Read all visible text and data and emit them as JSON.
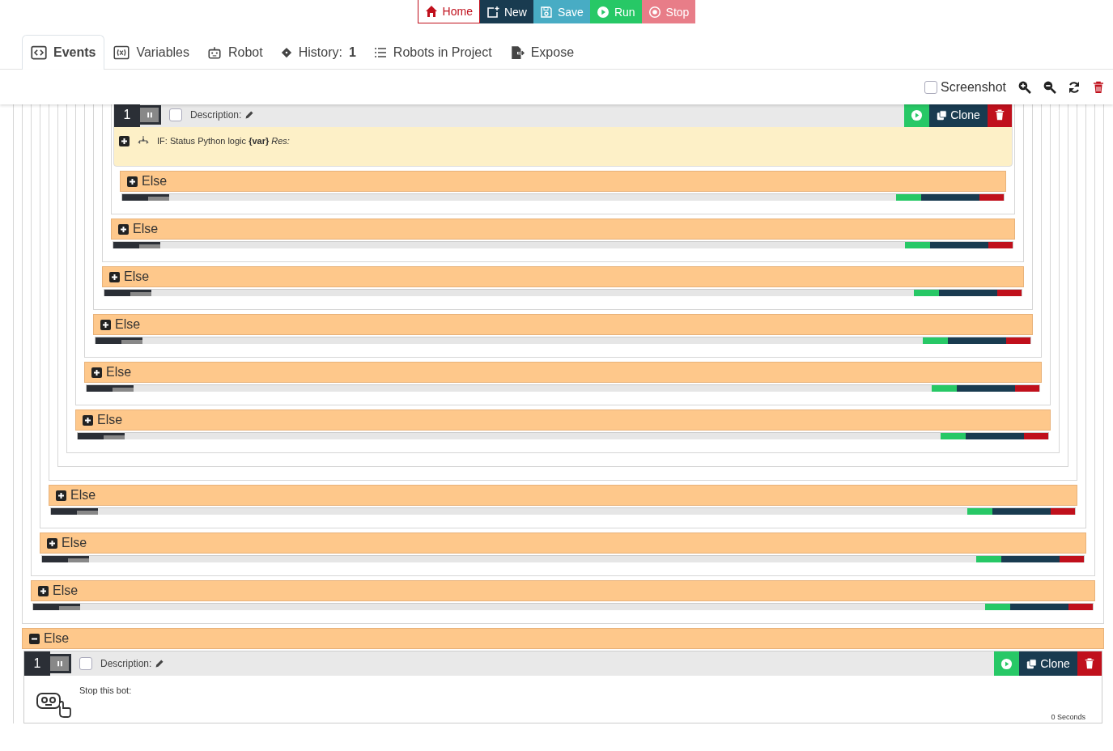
{
  "toolbar": [
    {
      "label": "Home",
      "kind": "home"
    },
    {
      "label": "New",
      "kind": "new"
    },
    {
      "label": "Save",
      "kind": "save"
    },
    {
      "label": "Run",
      "kind": "run"
    },
    {
      "label": "Stop",
      "kind": "stop"
    }
  ],
  "tabs": [
    {
      "label": "Events",
      "kind": "events",
      "selected": true
    },
    {
      "label": "Variables",
      "kind": "variables",
      "selected": false
    },
    {
      "label": "Robot",
      "kind": "robot",
      "selected": false
    },
    {
      "label": "History:",
      "count": "1",
      "kind": "history",
      "selected": false
    },
    {
      "label": "Robots in Project",
      "kind": "list",
      "selected": false
    },
    {
      "label": "Expose",
      "kind": "expose",
      "selected": false
    }
  ],
  "screenshot": {
    "label": "Screenshot",
    "checked": false
  },
  "top_event": {
    "number": "1",
    "checked": false,
    "description_label": "Description:",
    "clone_label": "Clone",
    "condition": "IF: Status Python logic **{var}** *Res:*"
  },
  "levels": [
    {
      "kind": "else",
      "label": "Else",
      "expanded": false
    },
    {
      "kind": "else",
      "label": "Else",
      "expanded": false
    },
    {
      "kind": "else",
      "label": "Else",
      "expanded": false
    },
    {
      "kind": "else",
      "label": "Else",
      "expanded": false
    },
    {
      "kind": "else",
      "label": "Else",
      "expanded": false
    },
    {
      "kind": "else",
      "label": "Else",
      "expanded": false
    },
    {
      "kind": "group"
    },
    {
      "kind": "group"
    },
    {
      "kind": "else",
      "label": "Else",
      "expanded": false
    },
    {
      "kind": "else",
      "label": "Else",
      "expanded": false
    },
    {
      "kind": "else",
      "label": "Else",
      "expanded": false
    },
    {
      "kind": "else",
      "label": "Else",
      "expanded": true,
      "event": {
        "number": "1",
        "checked": false,
        "description_label": "Description:",
        "clone_label": "Clone",
        "action": "Stop this bot:",
        "duration": "0 Seconds"
      }
    }
  ]
}
